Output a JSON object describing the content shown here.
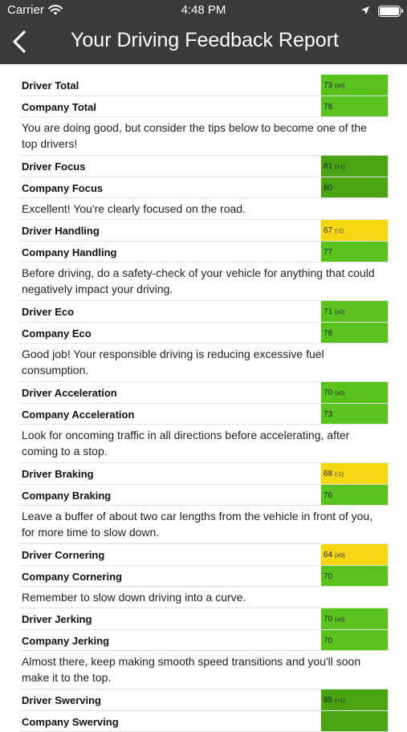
{
  "status": {
    "carrier": "Carrier",
    "time": "4:48 PM"
  },
  "header": {
    "title": "Your Driving Feedback Report",
    "back_icon": "chevron-left-icon"
  },
  "colors": {
    "header_bg": "#3a3a3a",
    "green": "#5ac21c",
    "dark_green": "#4aa313",
    "yellow": "#f5d711"
  },
  "sections": [
    {
      "driver": {
        "label": "Driver Total",
        "value": "73",
        "delta": "(±0)",
        "color": "#5ac21c"
      },
      "company": {
        "label": "Company Total",
        "value": "78",
        "color": "#5ac21c"
      },
      "message": "You are doing good, but consider the tips below to become one of the top drivers!"
    },
    {
      "driver": {
        "label": "Driver Focus",
        "value": "81",
        "delta": "(+1)",
        "color": "#4aa313"
      },
      "company": {
        "label": "Company Focus",
        "value": "80",
        "color": "#4aa313"
      },
      "message": "Excellent! You're clearly focused on the road."
    },
    {
      "driver": {
        "label": "Driver Handling",
        "value": "67",
        "delta": "(-1)",
        "color": "#f5d711"
      },
      "company": {
        "label": "Company Handling",
        "value": "77",
        "color": "#5ac21c"
      },
      "message": "Before driving, do a safety-check of your vehicle for anything that could negatively impact your driving."
    },
    {
      "driver": {
        "label": "Driver Eco",
        "value": "71",
        "delta": "(±0)",
        "color": "#5ac21c"
      },
      "company": {
        "label": "Company Eco",
        "value": "78",
        "color": "#5ac21c"
      },
      "message": "Good job! Your responsible driving is reducing excessive fuel consumption."
    },
    {
      "driver": {
        "label": "Driver Acceleration",
        "value": "70",
        "delta": "(±0)",
        "color": "#5ac21c"
      },
      "company": {
        "label": "Company Acceleration",
        "value": "73",
        "color": "#5ac21c"
      },
      "message": "Look for oncoming traffic in all directions before accelerating, after coming to a stop."
    },
    {
      "driver": {
        "label": "Driver Braking",
        "value": "68",
        "delta": "(-1)",
        "color": "#f5d711"
      },
      "company": {
        "label": "Company Braking",
        "value": "76",
        "color": "#5ac21c"
      },
      "message": "Leave a buffer of about two car lengths from the vehicle in front of you, for more time to slow down."
    },
    {
      "driver": {
        "label": "Driver Cornering",
        "value": "64",
        "delta": "(±0)",
        "color": "#f5d711"
      },
      "company": {
        "label": "Company Cornering",
        "value": "70",
        "color": "#5ac21c"
      },
      "message": "Remember to slow down driving into a curve."
    },
    {
      "driver": {
        "label": "Driver Jerking",
        "value": "70",
        "delta": "(±0)",
        "color": "#5ac21c"
      },
      "company": {
        "label": "Company Jerking",
        "value": "70",
        "color": "#5ac21c"
      },
      "message": "Almost there, keep making smooth speed transitions and you'll soon make it to the top."
    },
    {
      "driver": {
        "label": "Driver Swerving",
        "value": "85",
        "delta": "(+1)",
        "color": "#4aa313"
      },
      "company": {
        "label": "Company Swerving",
        "value": "",
        "color": "#4aa313"
      },
      "message": ""
    }
  ]
}
